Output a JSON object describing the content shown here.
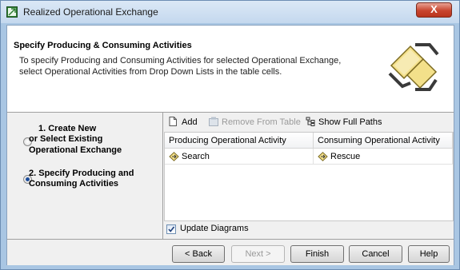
{
  "window": {
    "title": "Realized Operational Exchange",
    "close_label": "X"
  },
  "header": {
    "title": "Specify Producing & Consuming Activities",
    "description_line1": "To specify Producing and Consuming Activities for selected Operational Exchange,",
    "description_line2": "select Operational Activities from Drop Down Lists in the table cells."
  },
  "steps": [
    {
      "line1": "1. Create New",
      "line2": "or Select Existing",
      "line3": "Operational Exchange",
      "selected": false
    },
    {
      "line1": "2. Specify Producing and",
      "line2": "Consuming Activities",
      "selected": true
    }
  ],
  "toolbar": {
    "add_label": "Add",
    "remove_label": "Remove From Table",
    "show_paths_label": "Show Full Paths"
  },
  "table": {
    "columns": [
      "Producing Operational Activity",
      "Consuming Operational Activity"
    ],
    "rows": [
      {
        "producing": "Search",
        "consuming": "Rescue"
      }
    ]
  },
  "options": {
    "update_diagrams_label": "Update Diagrams",
    "update_diagrams_checked": true
  },
  "buttons": {
    "back": "< Back",
    "next": "Next >",
    "finish": "Finish",
    "cancel": "Cancel",
    "help": "Help"
  },
  "icons": {
    "title": "diagram-icon",
    "header": "exchange-graphic-icon",
    "add": "new-document-icon",
    "remove": "remove-table-icon",
    "show_paths": "tree-paths-icon",
    "cell": "operational-activity-icon"
  },
  "colors": {
    "titlebar": "#c4d8ee",
    "close_button": "#c8452e",
    "header_bg": "#ffffff",
    "panel_bg": "#f0f0f0"
  }
}
